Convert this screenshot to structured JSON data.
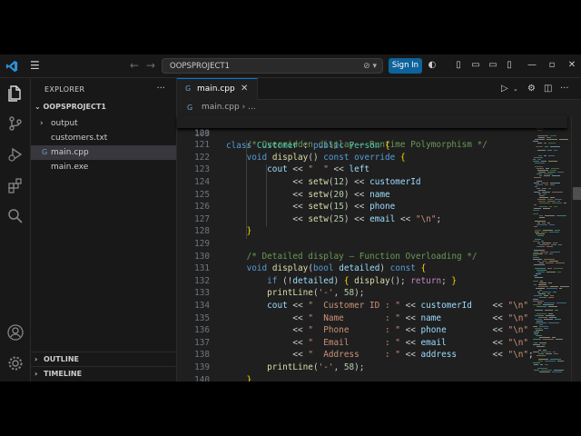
{
  "window": {
    "search_text": "OOPSPROJECT1",
    "signin_label": "Sign In",
    "accent": "#0078d4"
  },
  "activity_icons": [
    "explorer-icon",
    "source-control-icon",
    "run-debug-icon",
    "extensions-icon",
    "search-icon",
    "account-icon",
    "settings-icon"
  ],
  "sidebar": {
    "title": "EXPLORER",
    "project": "OOPSPROJECT1",
    "items": [
      {
        "label": "output",
        "type": "folder"
      },
      {
        "label": "customers.txt",
        "type": "file"
      },
      {
        "label": "main.cpp",
        "type": "cpp"
      },
      {
        "label": "main.exe",
        "type": "file"
      }
    ],
    "outline": "OUTLINE",
    "timeline": "TIMELINE"
  },
  "editor": {
    "tab_label": "main.cpp",
    "breadcrumb_file": "main.cpp",
    "breadcrumb_more": "...",
    "sticky": {
      "n": "103",
      "code": "class Customer : public Person {"
    },
    "lines": [
      {
        "n": "120",
        "code": ""
      },
      {
        "n": "121",
        "code": "    /* Overridden display – Runtime Polymorphism */"
      },
      {
        "n": "122",
        "code": "    void display() const override {"
      },
      {
        "n": "123",
        "code": "        cout << \"  \" << left"
      },
      {
        "n": "124",
        "code": "             << setw(12) << customerId"
      },
      {
        "n": "125",
        "code": "             << setw(20) << name"
      },
      {
        "n": "126",
        "code": "             << setw(15) << phone"
      },
      {
        "n": "127",
        "code": "             << setw(25) << email << \"\\n\";"
      },
      {
        "n": "128",
        "code": "    }"
      },
      {
        "n": "129",
        "code": ""
      },
      {
        "n": "130",
        "code": "    /* Detailed display – Function Overloading */"
      },
      {
        "n": "131",
        "code": "    void display(bool detailed) const {"
      },
      {
        "n": "132",
        "code": "        if (!detailed) { display(); return; }"
      },
      {
        "n": "133",
        "code": "        printLine('-', 58);"
      },
      {
        "n": "134",
        "code": "        cout << \"  Customer ID : \" << customerId    << \"\\n\""
      },
      {
        "n": "135",
        "code": "             << \"  Name        : \" << name          << \"\\n\""
      },
      {
        "n": "136",
        "code": "             << \"  Phone       : \" << phone         << \"\\n\""
      },
      {
        "n": "137",
        "code": "             << \"  Email       : \" << email         << \"\\n\""
      },
      {
        "n": "138",
        "code": "             << \"  Address     : \" << address       << \"\\n\";"
      },
      {
        "n": "139",
        "code": "        printLine('-', 58);"
      },
      {
        "n": "140",
        "code": "    }"
      }
    ]
  }
}
